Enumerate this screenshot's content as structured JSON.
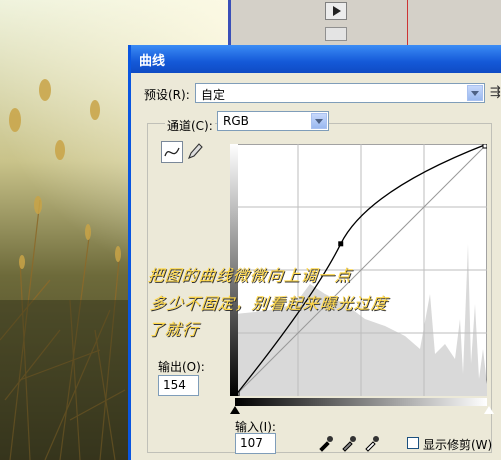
{
  "dialog": {
    "title": "曲线",
    "preset_label": "预设(R):",
    "preset_value": "自定",
    "channel_label": "通道(C):",
    "channel_value": "RGB",
    "output_label": "输出(O):",
    "output_value": "154",
    "input_label": "输入(I):",
    "input_value": "107",
    "show_clipping_label": "显示修剪(W)",
    "side_menu_glyph": "⇶"
  },
  "annotation": {
    "line1": "把图的曲线微微向上调一点",
    "line2": "多少不固定，别看起来曝光过度",
    "line3": "了就行"
  },
  "curve": {
    "input": 107,
    "output": 154
  },
  "colors": {
    "accent": "#0a56e0",
    "annotation": "#ffd84a"
  },
  "icons": [
    "play-icon",
    "curve-tool-icon",
    "pencil-tool-icon",
    "black-point-eyedropper-icon",
    "gray-point-eyedropper-icon",
    "white-point-eyedropper-icon",
    "dropdown-arrow-icon"
  ]
}
